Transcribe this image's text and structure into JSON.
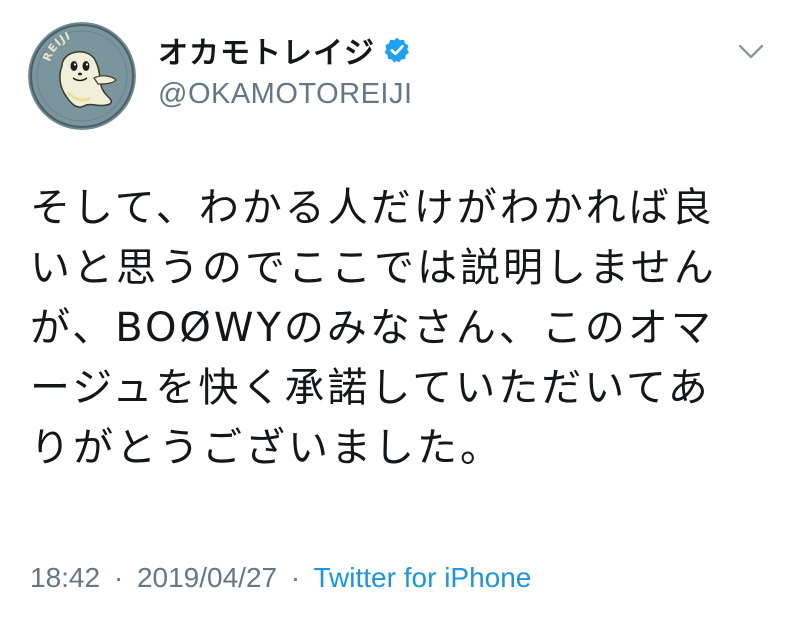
{
  "user": {
    "display_name": "オカモトレイジ",
    "handle": "@OKAMOTOREIJI",
    "verified": true,
    "avatar_icon": "ghost-badge-avatar",
    "avatar_text": "REIJI"
  },
  "tweet": {
    "lines": [
      "そして、わかる人だけがわかれば良",
      "いと思うのでここでは説明しません",
      "が、BOØWYのみなさん、このオマ",
      "ージュを快く承諾していただいてあ",
      "りがとうございました。"
    ]
  },
  "meta": {
    "time": "18:42",
    "separator": "·",
    "date": "2019/04/27",
    "source": "Twitter for iPhone"
  },
  "colors": {
    "text": "#14171a",
    "muted": "#657786",
    "link": "#1b95e0",
    "verified": "#1da1f2"
  },
  "icons": {
    "verified": "verified-badge-icon",
    "menu": "chevron-down-icon"
  }
}
